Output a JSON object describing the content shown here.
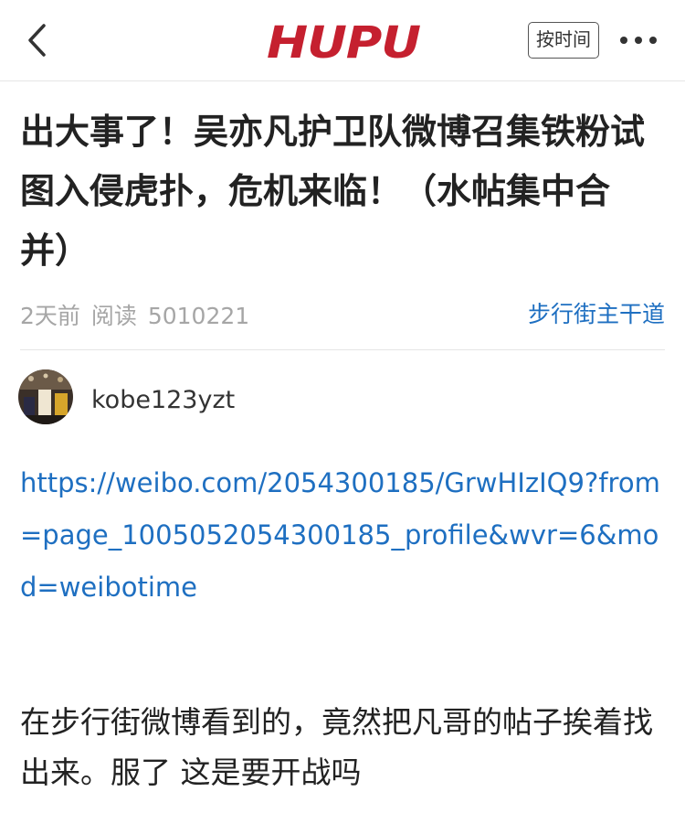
{
  "header": {
    "logo_text": "HUPU",
    "sort_label": "按时间",
    "back_icon": "chevron-left-icon",
    "more_icon": "more-dots-icon",
    "brand_color": "#c5202f"
  },
  "post": {
    "title": "出大事了！吴亦凡护卫队微博召集铁粉试图入侵虎扑，危机来临！（水帖集中合并）",
    "time": "2天前",
    "read_label": "阅读",
    "read_count": "5010221",
    "board": "步行街主干道"
  },
  "author": {
    "name": "kobe123yzt"
  },
  "body": {
    "link_text": "https://weibo.com/2054300185/GrwHIzIQ9?from=page_1005052054300185_profile&wvr=6&mod=weibotime",
    "text": "在步行街微博看到的，竟然把凡哥的帖子挨着找出来。服了 这是要开战吗"
  },
  "colors": {
    "link": "#1e6fc1",
    "meta": "#a6a6a6"
  }
}
